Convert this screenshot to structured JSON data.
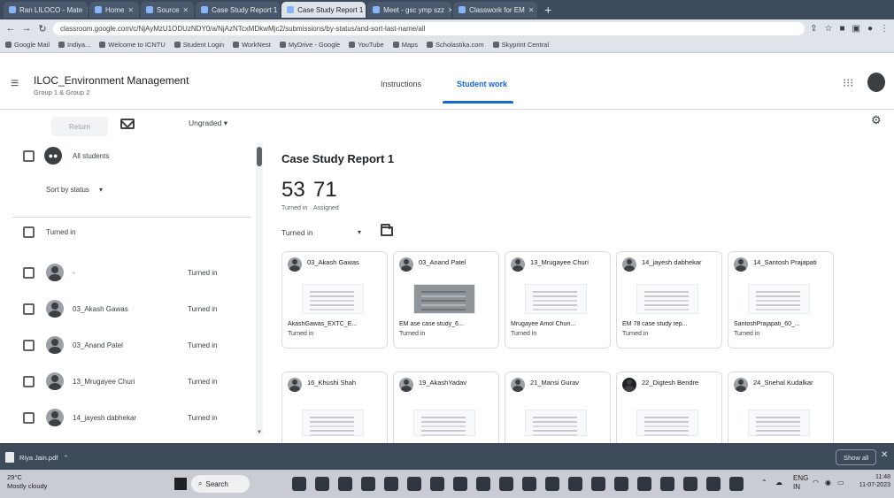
{
  "browser": {
    "tabs": [
      {
        "label": "Ran LILOCO - Mate",
        "active": false
      },
      {
        "label": "Home",
        "active": false
      },
      {
        "label": "Source",
        "active": false
      },
      {
        "label": "Case Study Report 1",
        "active": false
      },
      {
        "label": "Case Study Report 1",
        "active": true
      },
      {
        "label": "Meet - gsc ymp szz",
        "active": false
      },
      {
        "label": "Classwork for EM",
        "active": false
      }
    ],
    "url": "classroom.google.com/c/NjAyMzU1ODUzNDY0/a/NjAzNTcxMDkwMjc2/submissions/by-status/and-sort-last-name/all",
    "bookmarks": [
      "Google Mail",
      "Indiya...",
      "Welcome to ICNTU",
      "Student Login",
      "WorkNest",
      "MyDrive - Google",
      "YouTube",
      "Maps",
      "Scholastika.com",
      "Skyprint Central"
    ]
  },
  "classroom": {
    "course_title": "ILOC_Environment Management",
    "course_sub": "Group 1 & Group 2",
    "tabs": {
      "instructions": "Instructions",
      "student_work": "Student work"
    }
  },
  "toolbar": {
    "return_label": "Return",
    "grade_filter": "Ungraded"
  },
  "left_panel": {
    "all_students": "All students",
    "sort_label": "Sort by status",
    "section_turned_in": "Turned in",
    "students": [
      {
        "name": "-",
        "status": "Turned in"
      },
      {
        "name": "03_Akash Gawas",
        "status": "Turned in"
      },
      {
        "name": "03_Anand Patel",
        "status": "Turned in"
      },
      {
        "name": "13_Mrugayee Churi",
        "status": "Turned in"
      },
      {
        "name": "14_jayesh dabhekar",
        "status": "Turned in"
      }
    ]
  },
  "assignment": {
    "title": "Case Study Report 1",
    "turned_in_count": "53",
    "turned_in_label": "Turned in",
    "assigned_count": "71",
    "assigned_label": "Assigned",
    "filter": "Turned in",
    "cards": [
      {
        "name": "03_Akash Gawas",
        "file": "AkashGawas_EXTC_E...",
        "status": "Turned in"
      },
      {
        "name": "03_Anand Patel",
        "file": "EM ase case study_6...",
        "status": "Turned in"
      },
      {
        "name": "13_Mrugayee Churi",
        "file": "Mrugayee Amol Churi...",
        "status": "Turned in"
      },
      {
        "name": "14_jayesh dabhekar",
        "file": "EM 78 case study rep...",
        "status": "Turned in"
      },
      {
        "name": "14_Santosh Prajapati",
        "file": "SantoshPrajapati_60_...",
        "status": "Turned in"
      },
      {
        "name": "16_Khushi Shah",
        "file": "",
        "status": ""
      },
      {
        "name": "19_AkashYadav",
        "file": "",
        "status": ""
      },
      {
        "name": "21_Mansi Gurav",
        "file": "",
        "status": ""
      },
      {
        "name": "22_Digtesh Bendre",
        "file": "",
        "status": ""
      },
      {
        "name": "24_Snehal Kudalkar",
        "file": "",
        "status": ""
      }
    ]
  },
  "download_bar": {
    "file": "Riya Jain.pdf",
    "show_all": "Show all"
  },
  "taskbar": {
    "temp": "29°C",
    "weather": "Mostly cloudy",
    "search": "Search",
    "lang_1": "ENG",
    "lang_2": "IN",
    "time": "11:48",
    "date": "11-07-2023"
  }
}
